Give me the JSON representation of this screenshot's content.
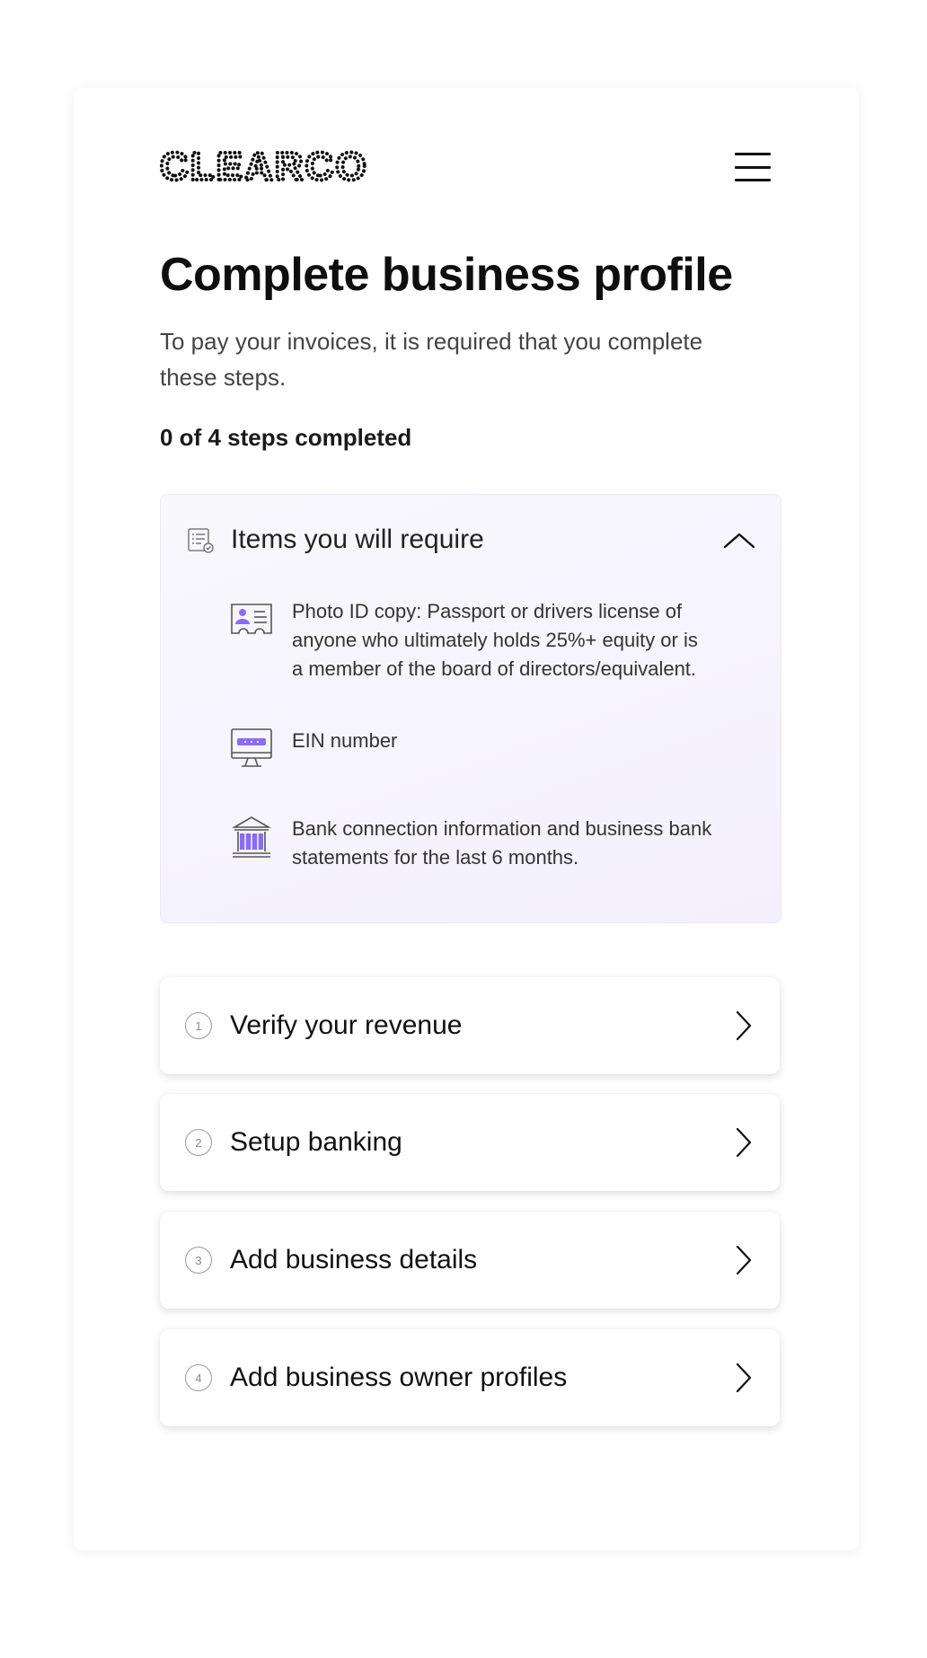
{
  "brand": {
    "logo_text": "CLEARCO"
  },
  "page": {
    "title": "Complete business profile",
    "subtitle": "To pay your invoices, it is required that you complete these steps.",
    "progress": "0 of 4 steps completed"
  },
  "requirements": {
    "title": "Items you will require",
    "items": [
      {
        "icon": "id-card-icon",
        "text": "Photo ID copy: Passport or drivers license of anyone who ultimately holds 25%+ equity or is a member of the board of directors/equivalent."
      },
      {
        "icon": "monitor-icon",
        "text": "EIN number"
      },
      {
        "icon": "bank-icon",
        "text": "Bank connection information and business bank statements for the last 6 months."
      }
    ]
  },
  "steps": [
    {
      "number": "1",
      "label": "Verify your revenue"
    },
    {
      "number": "2",
      "label": "Setup banking"
    },
    {
      "number": "3",
      "label": "Add business details"
    },
    {
      "number": "4",
      "label": "Add business owner profiles"
    }
  ],
  "colors": {
    "accent": "#7b61ff",
    "panel_bg": "#f5f3fd",
    "text": "#111111"
  }
}
